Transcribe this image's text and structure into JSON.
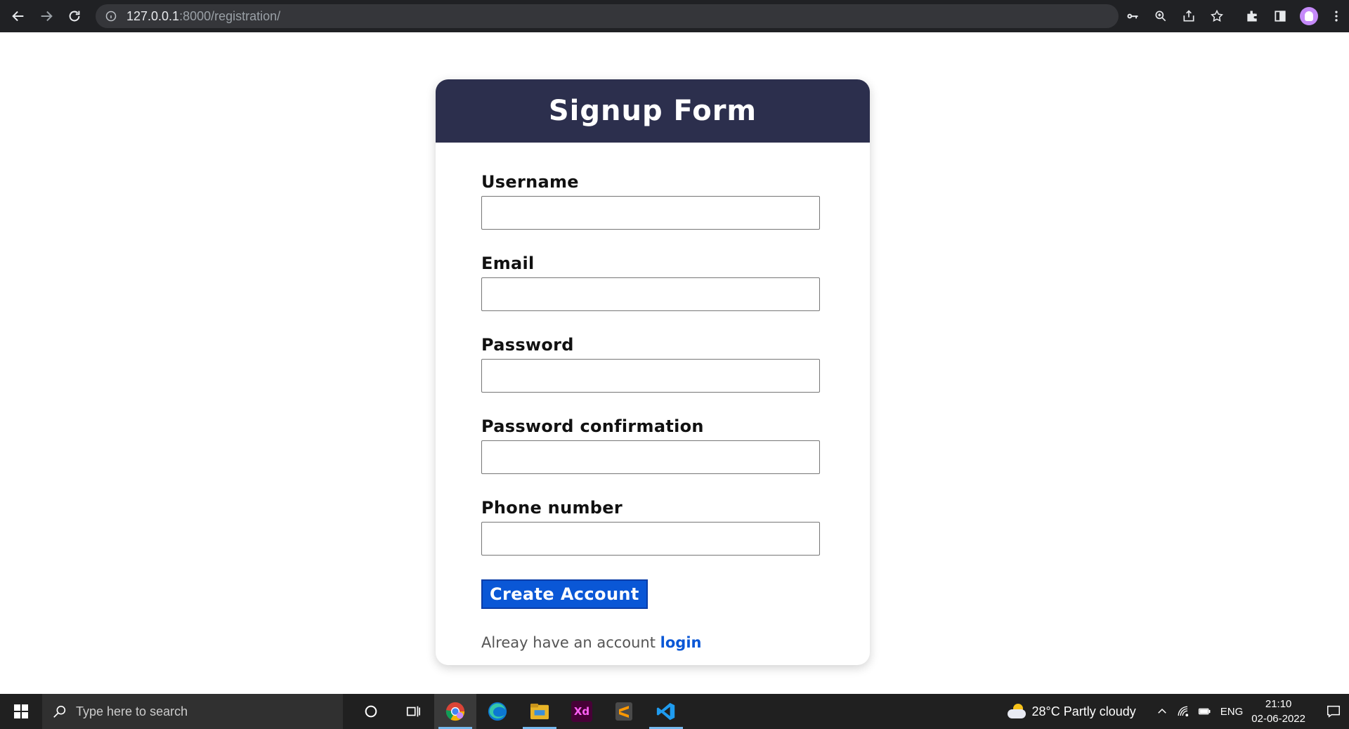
{
  "browser": {
    "url_host": "127.0.0.1",
    "url_path": ":8000/registration/"
  },
  "form": {
    "title": "Signup Form",
    "fields": [
      {
        "label": "Username",
        "value": ""
      },
      {
        "label": "Email",
        "value": ""
      },
      {
        "label": "Password",
        "value": ""
      },
      {
        "label": "Password confirmation",
        "value": ""
      },
      {
        "label": "Phone number",
        "value": ""
      }
    ],
    "submit_label": "Create Account",
    "login_prompt": "Alreay have an account ",
    "login_link": "login"
  },
  "taskbar": {
    "search_placeholder": "Type here to search",
    "weather": "28°C  Partly cloudy",
    "language": "ENG",
    "time": "21:10",
    "date": "02-06-2022"
  },
  "colors": {
    "header_bg": "#2c2f4d",
    "button_bg": "#0a57d6",
    "link": "#0a57d6"
  }
}
